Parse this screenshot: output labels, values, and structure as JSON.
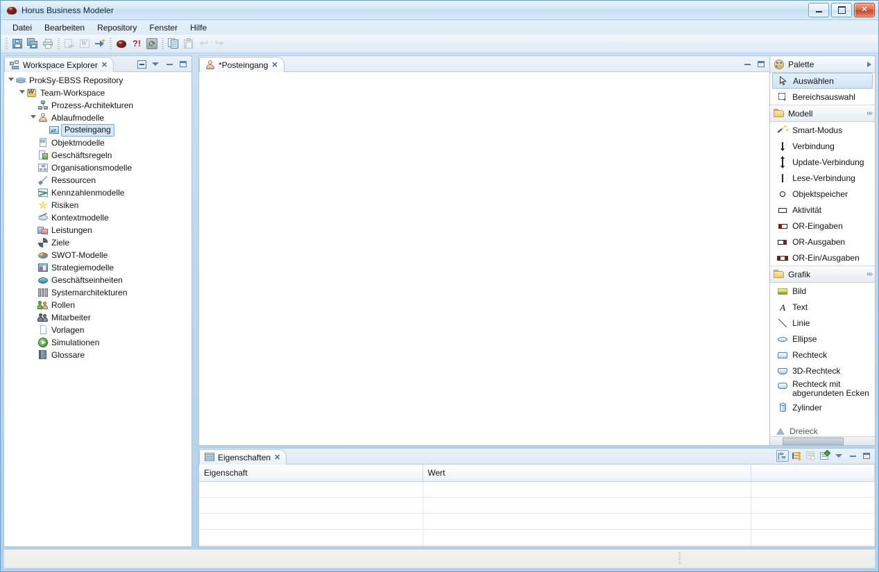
{
  "window": {
    "title": "Horus Business Modeler",
    "app_icon": "horus-ball-icon",
    "buttons": {
      "minimize": "minimize",
      "maximize": "maximize",
      "close": "close"
    }
  },
  "menubar": {
    "items": [
      {
        "label": "Datei"
      },
      {
        "label": "Bearbeiten"
      },
      {
        "label": "Repository"
      },
      {
        "label": "Fenster"
      },
      {
        "label": "Hilfe"
      }
    ]
  },
  "toolbar": {
    "groups": [
      {
        "buttons": [
          {
            "name": "save-button",
            "icon": "save-icon",
            "enabled": true
          },
          {
            "name": "save-all-button",
            "icon": "save-all-icon",
            "enabled": true
          },
          {
            "name": "print-button",
            "icon": "print-icon",
            "enabled": true
          }
        ]
      },
      {
        "buttons": [
          {
            "name": "export-button",
            "icon": "export-image-icon",
            "enabled": false
          },
          {
            "name": "word-export-button",
            "icon": "word-document-icon",
            "enabled": false
          },
          {
            "name": "publish-button",
            "icon": "arrow-publish-icon",
            "enabled": true
          }
        ]
      },
      {
        "buttons": [
          {
            "name": "horus-button",
            "icon": "horus-ball-icon",
            "enabled": true
          },
          {
            "name": "help-button",
            "icon": "question-exclamation-icon",
            "enabled": true
          },
          {
            "name": "refresh-button",
            "icon": "refresh-icon",
            "enabled": true
          }
        ]
      },
      {
        "buttons": [
          {
            "name": "copy-button",
            "icon": "copy-icon",
            "enabled": true
          },
          {
            "name": "paste-button",
            "icon": "paste-icon",
            "enabled": false
          },
          {
            "name": "undo-button",
            "icon": "undo-arrow-icon",
            "enabled": false
          },
          {
            "name": "redo-button",
            "icon": "redo-arrow-icon",
            "enabled": false
          }
        ]
      }
    ]
  },
  "explorer": {
    "tab_label": "Workspace Explorer",
    "tab_icon": "workspace-explorer-icon",
    "close_glyph": "✕",
    "tools": [
      {
        "name": "collapse-all-button",
        "icon": "collapse-all-icon"
      },
      {
        "name": "view-menu-button",
        "icon": "chevron-down-icon"
      },
      {
        "name": "minimize-view-button",
        "icon": "minimize-icon"
      },
      {
        "name": "maximize-view-button",
        "icon": "maximize-icon"
      }
    ],
    "tree": [
      {
        "label": "ProkSy-EBSS Repository",
        "icon": "repository-icon",
        "depth": 0,
        "twisty": "open",
        "selected": false
      },
      {
        "label": "Team-Workspace",
        "icon": "team-workspace-icon",
        "depth": 1,
        "twisty": "open",
        "selected": false
      },
      {
        "label": "Prozess-Architekturen",
        "icon": "process-architecture-icon",
        "depth": 2,
        "twisty": "none",
        "selected": false
      },
      {
        "label": "Ablaufmodelle",
        "icon": "process-model-icon",
        "depth": 2,
        "twisty": "open",
        "selected": false
      },
      {
        "label": "Posteingang",
        "icon": "inbox-model-icon",
        "depth": 3,
        "twisty": "none",
        "selected": true
      },
      {
        "label": "Objektmodelle",
        "icon": "object-model-icon",
        "depth": 2,
        "twisty": "none",
        "selected": false
      },
      {
        "label": "Geschäftsregeln",
        "icon": "business-rules-icon",
        "depth": 2,
        "twisty": "none",
        "selected": false
      },
      {
        "label": "Organisationsmodelle",
        "icon": "organisation-model-icon",
        "depth": 2,
        "twisty": "none",
        "selected": false
      },
      {
        "label": "Ressourcen",
        "icon": "resources-icon",
        "depth": 2,
        "twisty": "none",
        "selected": false
      },
      {
        "label": "Kennzahlenmodelle",
        "icon": "kpi-model-icon",
        "depth": 2,
        "twisty": "none",
        "selected": false
      },
      {
        "label": "Risiken",
        "icon": "risk-icon",
        "depth": 2,
        "twisty": "none",
        "selected": false
      },
      {
        "label": "Kontextmodelle",
        "icon": "context-model-icon",
        "depth": 2,
        "twisty": "none",
        "selected": false
      },
      {
        "label": "Leistungen",
        "icon": "services-icon",
        "depth": 2,
        "twisty": "none",
        "selected": false
      },
      {
        "label": "Ziele",
        "icon": "goals-icon",
        "depth": 2,
        "twisty": "none",
        "selected": false
      },
      {
        "label": "SWOT-Modelle",
        "icon": "swot-model-icon",
        "depth": 2,
        "twisty": "none",
        "selected": false
      },
      {
        "label": "Strategiemodelle",
        "icon": "strategy-model-icon",
        "depth": 2,
        "twisty": "none",
        "selected": false
      },
      {
        "label": "Geschäftseinheiten",
        "icon": "business-unit-icon",
        "depth": 2,
        "twisty": "none",
        "selected": false
      },
      {
        "label": "Systemarchitekturen",
        "icon": "system-architecture-icon",
        "depth": 2,
        "twisty": "none",
        "selected": false
      },
      {
        "label": "Rollen",
        "icon": "roles-icon",
        "depth": 2,
        "twisty": "none",
        "selected": false
      },
      {
        "label": "Mitarbeiter",
        "icon": "employees-icon",
        "depth": 2,
        "twisty": "none",
        "selected": false
      },
      {
        "label": "Vorlagen",
        "icon": "templates-icon",
        "depth": 2,
        "twisty": "none",
        "selected": false
      },
      {
        "label": "Simulationen",
        "icon": "simulations-icon",
        "depth": 2,
        "twisty": "none",
        "selected": false
      },
      {
        "label": "Glossare",
        "icon": "glossary-icon",
        "depth": 2,
        "twisty": "none",
        "selected": false
      }
    ]
  },
  "editor": {
    "tab_label": "*Posteingang",
    "tab_icon": "process-model-icon",
    "close_glyph": "✕",
    "tools": [
      {
        "name": "minimize-editor-button",
        "icon": "minimize-icon"
      },
      {
        "name": "maximize-editor-button",
        "icon": "maximize-icon"
      }
    ]
  },
  "palette": {
    "title": "Palette",
    "title_icon": "palette-icon",
    "title_arrow": "chevron-right-icon",
    "top_items": [
      {
        "label": "Auswählen",
        "icon": "cursor-arrow-icon",
        "selected": true
      },
      {
        "label": "Bereichsauswahl",
        "icon": "marquee-select-icon",
        "selected": false
      }
    ],
    "drawers": [
      {
        "title": "Modell",
        "title_icon": "open-folder-icon",
        "collapse_icon": "double-chevron-icon",
        "items": [
          {
            "label": "Smart-Modus",
            "icon": "magic-wand-icon"
          },
          {
            "label": "Verbindung",
            "icon": "arrow-down-icon"
          },
          {
            "label": "Update-Verbindung",
            "icon": "arrow-up-down-icon"
          },
          {
            "label": "Lese-Verbindung",
            "icon": "vertical-line-icon"
          },
          {
            "label": "Objektspeicher",
            "icon": "circle-icon"
          },
          {
            "label": "Aktivität",
            "icon": "rectangle-icon"
          },
          {
            "label": "OR-Eingaben",
            "icon": "or-input-icon"
          },
          {
            "label": "OR-Ausgaben",
            "icon": "or-output-icon"
          },
          {
            "label": "OR-Ein/Ausgaben",
            "icon": "or-inout-icon"
          }
        ]
      },
      {
        "title": "Grafik",
        "title_icon": "open-folder-icon",
        "collapse_icon": "double-chevron-icon",
        "items": [
          {
            "label": "Bild",
            "icon": "image-icon"
          },
          {
            "label": "Text",
            "icon": "text-icon"
          },
          {
            "label": "Linie",
            "icon": "line-icon"
          },
          {
            "label": "Ellipse",
            "icon": "ellipse-icon"
          },
          {
            "label": "Rechteck",
            "icon": "rectangle-shape-icon"
          },
          {
            "label": "3D-Rechteck",
            "icon": "rectangle-3d-icon"
          },
          {
            "label": "Rechteck mit abgerundeten Ecken",
            "icon": "rounded-rectangle-icon"
          },
          {
            "label": "Zylinder",
            "icon": "cylinder-icon"
          },
          {
            "label": "Dreieck",
            "icon": "triangle-icon"
          }
        ]
      }
    ]
  },
  "properties": {
    "tab_label": "Eigenschaften",
    "tab_icon": "properties-table-icon",
    "close_glyph": "✕",
    "tools": [
      {
        "name": "show-categories-button",
        "icon": "tree-categories-icon",
        "active": true
      },
      {
        "name": "show-advanced-button",
        "icon": "advanced-properties-icon",
        "active": false
      },
      {
        "name": "restore-defaults-button",
        "icon": "restore-defaults-icon",
        "active": false
      },
      {
        "name": "new-property-button",
        "icon": "new-property-icon",
        "active": false
      },
      {
        "name": "view-menu-button",
        "icon": "chevron-down-icon",
        "active": false
      },
      {
        "name": "minimize-view-button",
        "icon": "minimize-icon",
        "active": false
      },
      {
        "name": "maximize-view-button",
        "icon": "maximize-icon",
        "active": false
      }
    ],
    "columns": [
      "Eigenschaft",
      "Wert",
      ""
    ],
    "rows": [
      [
        "",
        "",
        ""
      ],
      [
        "",
        "",
        ""
      ],
      [
        "",
        "",
        ""
      ],
      [
        "",
        "",
        ""
      ],
      [
        "",
        "",
        ""
      ]
    ]
  },
  "statusbar": {
    "text": "",
    "grip_icon": "resize-grip-icon"
  }
}
